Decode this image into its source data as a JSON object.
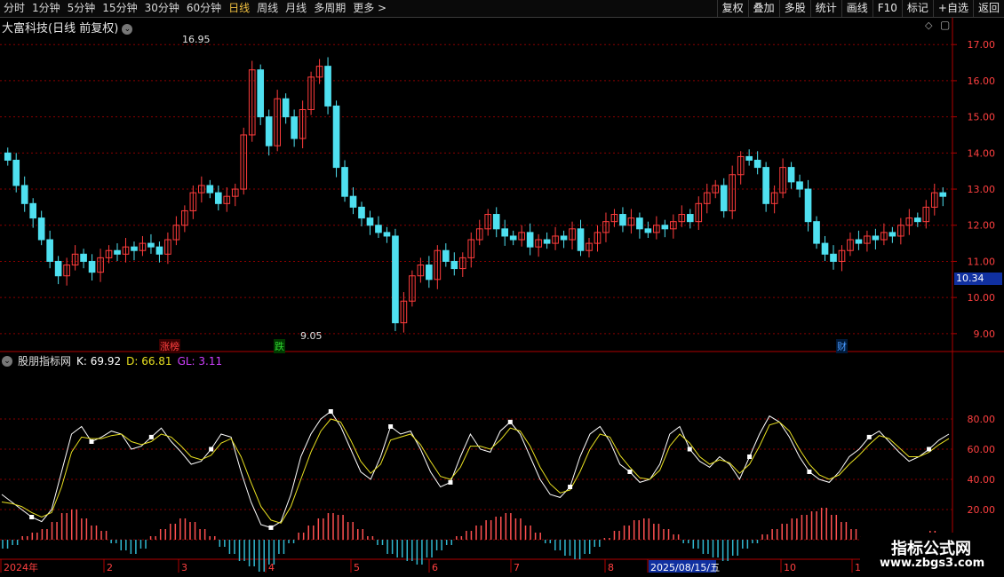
{
  "toolbar": {
    "periods": [
      "分时",
      "1分钟",
      "5分钟",
      "15分钟",
      "30分钟",
      "60分钟",
      "日线",
      "周线",
      "月线",
      "多周期",
      "更多 >"
    ],
    "active_period": "日线",
    "tools": [
      "复权",
      "叠加",
      "多股",
      "统计",
      "画线",
      "F10",
      "标记",
      "+自选",
      "返回"
    ]
  },
  "main": {
    "title": "大富科技(日线 前复权)",
    "high_label": "16.95",
    "low_label": "9.05",
    "current_price": "10.34",
    "event_tags": [
      {
        "text": "涨榜",
        "color": "#ff4040"
      },
      {
        "text": "跌",
        "color": "#30c030"
      },
      {
        "text": "财",
        "color": "#4a9bff"
      }
    ],
    "y_ticks": [
      "17.00",
      "16.00",
      "15.00",
      "14.00",
      "13.00",
      "12.00",
      "11.00",
      "10.00",
      "9.00"
    ]
  },
  "indicator": {
    "name": "股朋指标网",
    "k": "K: 69.92",
    "d": "D: 66.81",
    "gl": "GL: 3.11",
    "y_ticks": [
      "80.00",
      "60.00",
      "40.00",
      "20.00",
      "0.00"
    ]
  },
  "xaxis": {
    "labels": [
      "2024年",
      "2",
      "3",
      "4",
      "5",
      "6",
      "7",
      "8",
      "2025/08/15/五",
      "10",
      "11"
    ]
  },
  "watermark": {
    "title": "指标公式网",
    "url": "www.zbgs3.com"
  },
  "colors": {
    "up": "#ff3c3c",
    "down": "#4fe0f0",
    "k_line": "#ffffff",
    "d_line": "#e8e020",
    "grid": "#8a0000"
  },
  "chart_data": {
    "type": "candlestick",
    "price_ylim": [
      8.8,
      17.3
    ],
    "closes": [
      13.8,
      13.1,
      12.6,
      12.2,
      11.6,
      11.0,
      10.6,
      10.9,
      11.2,
      11.0,
      10.7,
      11.1,
      11.3,
      11.2,
      11.4,
      11.3,
      11.5,
      11.4,
      11.2,
      11.6,
      12.0,
      12.4,
      12.9,
      13.1,
      12.9,
      12.6,
      12.8,
      13.0,
      14.5,
      16.3,
      15.0,
      14.2,
      15.5,
      15.0,
      14.4,
      15.2,
      16.1,
      16.4,
      15.3,
      13.6,
      12.8,
      12.5,
      12.2,
      12.0,
      11.8,
      11.7,
      9.3,
      9.9,
      10.6,
      10.9,
      10.5,
      11.3,
      11.0,
      10.8,
      11.1,
      11.6,
      11.9,
      12.3,
      11.9,
      11.7,
      11.6,
      11.8,
      11.4,
      11.6,
      11.5,
      11.7,
      11.6,
      11.9,
      11.3,
      11.5,
      11.8,
      12.1,
      12.3,
      12.0,
      12.2,
      11.9,
      11.8,
      12.0,
      11.9,
      12.1,
      12.3,
      12.1,
      12.6,
      12.9,
      13.1,
      12.4,
      13.4,
      13.9,
      13.8,
      13.6,
      12.6,
      12.9,
      13.6,
      13.2,
      13.0,
      12.1,
      11.5,
      11.2,
      11.0,
      11.3,
      11.6,
      11.5,
      11.7,
      11.6,
      11.8,
      11.7,
      12.0,
      12.2,
      12.1,
      12.5,
      12.9,
      12.8
    ],
    "k_values": [
      30,
      25,
      20,
      15,
      12,
      20,
      45,
      70,
      75,
      65,
      68,
      72,
      70,
      60,
      62,
      68,
      74,
      65,
      58,
      50,
      52,
      60,
      70,
      68,
      45,
      25,
      10,
      8,
      12,
      30,
      55,
      70,
      80,
      85,
      75,
      60,
      45,
      40,
      55,
      75,
      70,
      72,
      60,
      45,
      35,
      38,
      55,
      70,
      60,
      58,
      72,
      78,
      70,
      55,
      40,
      30,
      28,
      35,
      55,
      70,
      75,
      65,
      50,
      45,
      38,
      40,
      50,
      70,
      75,
      60,
      52,
      48,
      55,
      50,
      40,
      55,
      70,
      82,
      78,
      68,
      55,
      45,
      40,
      38,
      45,
      55,
      60,
      68,
      72,
      65,
      58,
      52,
      55,
      60,
      66,
      70
    ],
    "d_values": [
      25,
      24,
      22,
      18,
      15,
      18,
      35,
      58,
      68,
      67,
      67,
      69,
      70,
      65,
      63,
      65,
      70,
      68,
      62,
      55,
      53,
      56,
      64,
      67,
      55,
      38,
      22,
      13,
      11,
      22,
      40,
      58,
      72,
      80,
      78,
      66,
      52,
      44,
      50,
      66,
      68,
      70,
      63,
      52,
      42,
      40,
      48,
      62,
      62,
      60,
      66,
      74,
      72,
      62,
      48,
      37,
      31,
      33,
      45,
      60,
      70,
      68,
      56,
      48,
      41,
      40,
      46,
      62,
      70,
      64,
      55,
      50,
      53,
      51,
      44,
      50,
      62,
      76,
      78,
      72,
      60,
      50,
      43,
      40,
      43,
      50,
      56,
      63,
      69,
      67,
      61,
      55,
      55,
      58,
      63,
      67
    ],
    "gl_values": [
      -5,
      -3,
      2,
      4,
      6,
      10,
      15,
      17,
      12,
      8,
      5,
      -2,
      -6,
      -8,
      -5,
      2,
      6,
      9,
      12,
      10,
      6,
      2,
      -4,
      -8,
      -12,
      -15,
      -18,
      -14,
      -8,
      -2,
      4,
      8,
      12,
      15,
      14,
      10,
      6,
      2,
      -3,
      -8,
      -10,
      -12,
      -14,
      -10,
      -6,
      -3,
      2,
      5,
      8,
      11,
      13,
      15,
      12,
      8,
      4,
      -2,
      -6,
      -9,
      -11,
      -8,
      -4,
      1,
      5,
      8,
      11,
      12,
      9,
      6,
      3,
      -2,
      -5,
      -8,
      -10,
      -12,
      -9,
      -5,
      -2,
      3,
      6,
      9,
      12,
      14,
      16,
      18,
      14,
      10,
      6,
      2,
      -3,
      -6,
      -4,
      -2,
      2,
      4,
      5,
      3
    ]
  }
}
